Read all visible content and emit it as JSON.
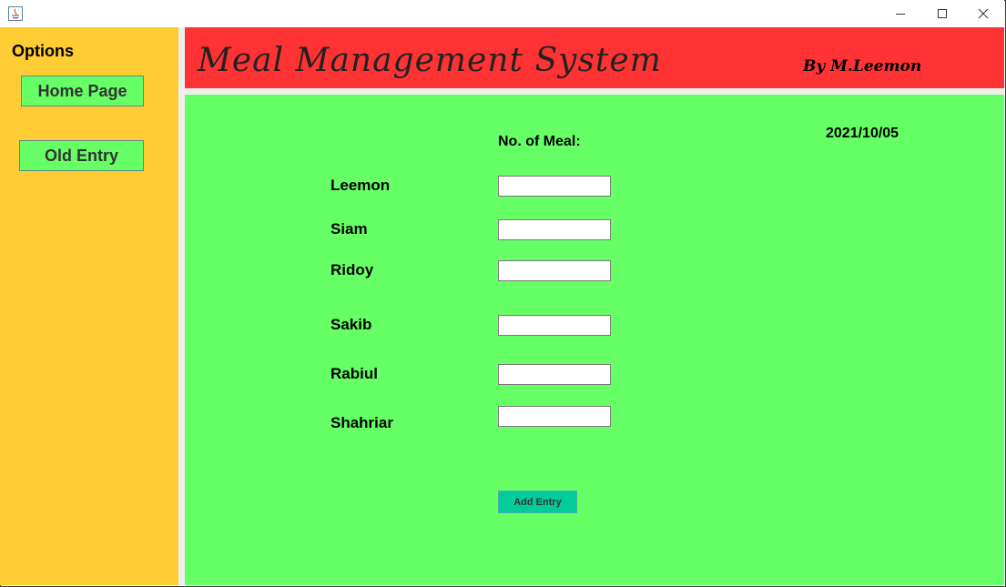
{
  "window": {
    "controls": [
      "minimize-icon",
      "maximize-icon",
      "close-icon"
    ]
  },
  "sidebar": {
    "title": "Options",
    "buttons": [
      {
        "label": "Home Page"
      },
      {
        "label": "Old Entry"
      }
    ]
  },
  "header": {
    "title": "Meal Management System",
    "byline": "By M.Leemon"
  },
  "form": {
    "date": "2021/10/05",
    "column_label": "No. of Meal:",
    "members": [
      {
        "name": "Leemon",
        "value": ""
      },
      {
        "name": "Siam",
        "value": ""
      },
      {
        "name": "Ridoy",
        "value": ""
      },
      {
        "name": "Sakib",
        "value": ""
      },
      {
        "name": "Rabiul",
        "value": ""
      },
      {
        "name": "Shahriar",
        "value": ""
      }
    ],
    "submit_label": "Add Entry"
  },
  "colors": {
    "sidebar": "#ffcc33",
    "header": "#ff3333",
    "main": "#66ff66",
    "add_button": "#00cc99"
  }
}
